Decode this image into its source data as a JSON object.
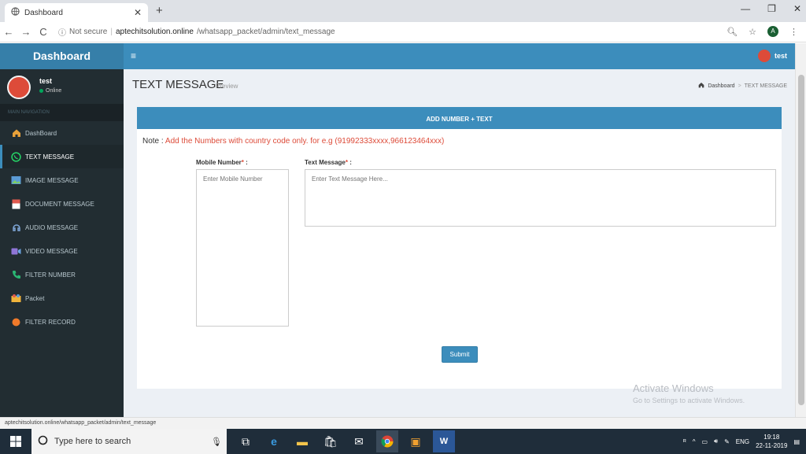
{
  "browser": {
    "tab_title": "Dashboard",
    "new_tab": "+",
    "security_label": "Not secure",
    "url_host": "aptechitsolution.online",
    "url_path": "/whatsapp_packet/admin/text_message",
    "status_url": "aptechitsolution.online/whatsapp_packet/admin/text_message",
    "profile_initial": "A"
  },
  "header": {
    "logo": "Dashboard",
    "menu_icon": "≡",
    "user": "test"
  },
  "sidebar": {
    "user_name": "test",
    "user_status": "Online",
    "nav_header": "MAIN NAVIGATION",
    "items": [
      {
        "label": "DashBoard",
        "icon": "home-icon",
        "color": "#e8a13a"
      },
      {
        "label": "TEXT MESSAGE",
        "icon": "whatsapp-icon",
        "color": "#25d366"
      },
      {
        "label": "IMAGE MESSAGE",
        "icon": "image-icon",
        "color": "#5b9bd5"
      },
      {
        "label": "DOCUMENT MESSAGE",
        "icon": "document-icon",
        "color": "#e05a4f"
      },
      {
        "label": "AUDIO MESSAGE",
        "icon": "audio-icon",
        "color": "#7fa7d8"
      },
      {
        "label": "VIDEO MESSAGE",
        "icon": "video-icon",
        "color": "#8f76d6"
      },
      {
        "label": "FILTER NUMBER",
        "icon": "phone-icon",
        "color": "#2bb673"
      },
      {
        "label": "Packet",
        "icon": "packet-icon",
        "color": "#f0b43c"
      },
      {
        "label": "FILTER RECORD",
        "icon": "record-icon",
        "color": "#f07a2a"
      }
    ]
  },
  "page": {
    "title": "TEXT MESSAGE",
    "subtitle": "Preview",
    "breadcrumb_home": "Dashboard",
    "breadcrumb_sep": ">",
    "breadcrumb_current": "TEXT MESSAGE"
  },
  "form": {
    "box_title": "ADD NUMBER + TEXT",
    "note_prefix": "Note : ",
    "note_text": "Add the Numbers with country code only. for e.g (91992333xxxx,966123464xxx)",
    "mobile_label": "Mobile Number",
    "mobile_placeholder": "Enter Mobile Number",
    "message_label": "Text Message",
    "message_placeholder": "Enter Text Message Here...",
    "required_mark": "*",
    "label_suffix": " :",
    "submit_label": "Submit"
  },
  "watermark": {
    "line1": "Activate Windows",
    "line2": "Go to Settings to activate Windows."
  },
  "taskbar": {
    "search_placeholder": "Type here to search",
    "language": "ENG",
    "time": "19:18",
    "date": "22-11-2019"
  },
  "colors": {
    "primary": "#3c8dbc",
    "sidebar_bg": "#222d32",
    "danger": "#dd4b39"
  }
}
